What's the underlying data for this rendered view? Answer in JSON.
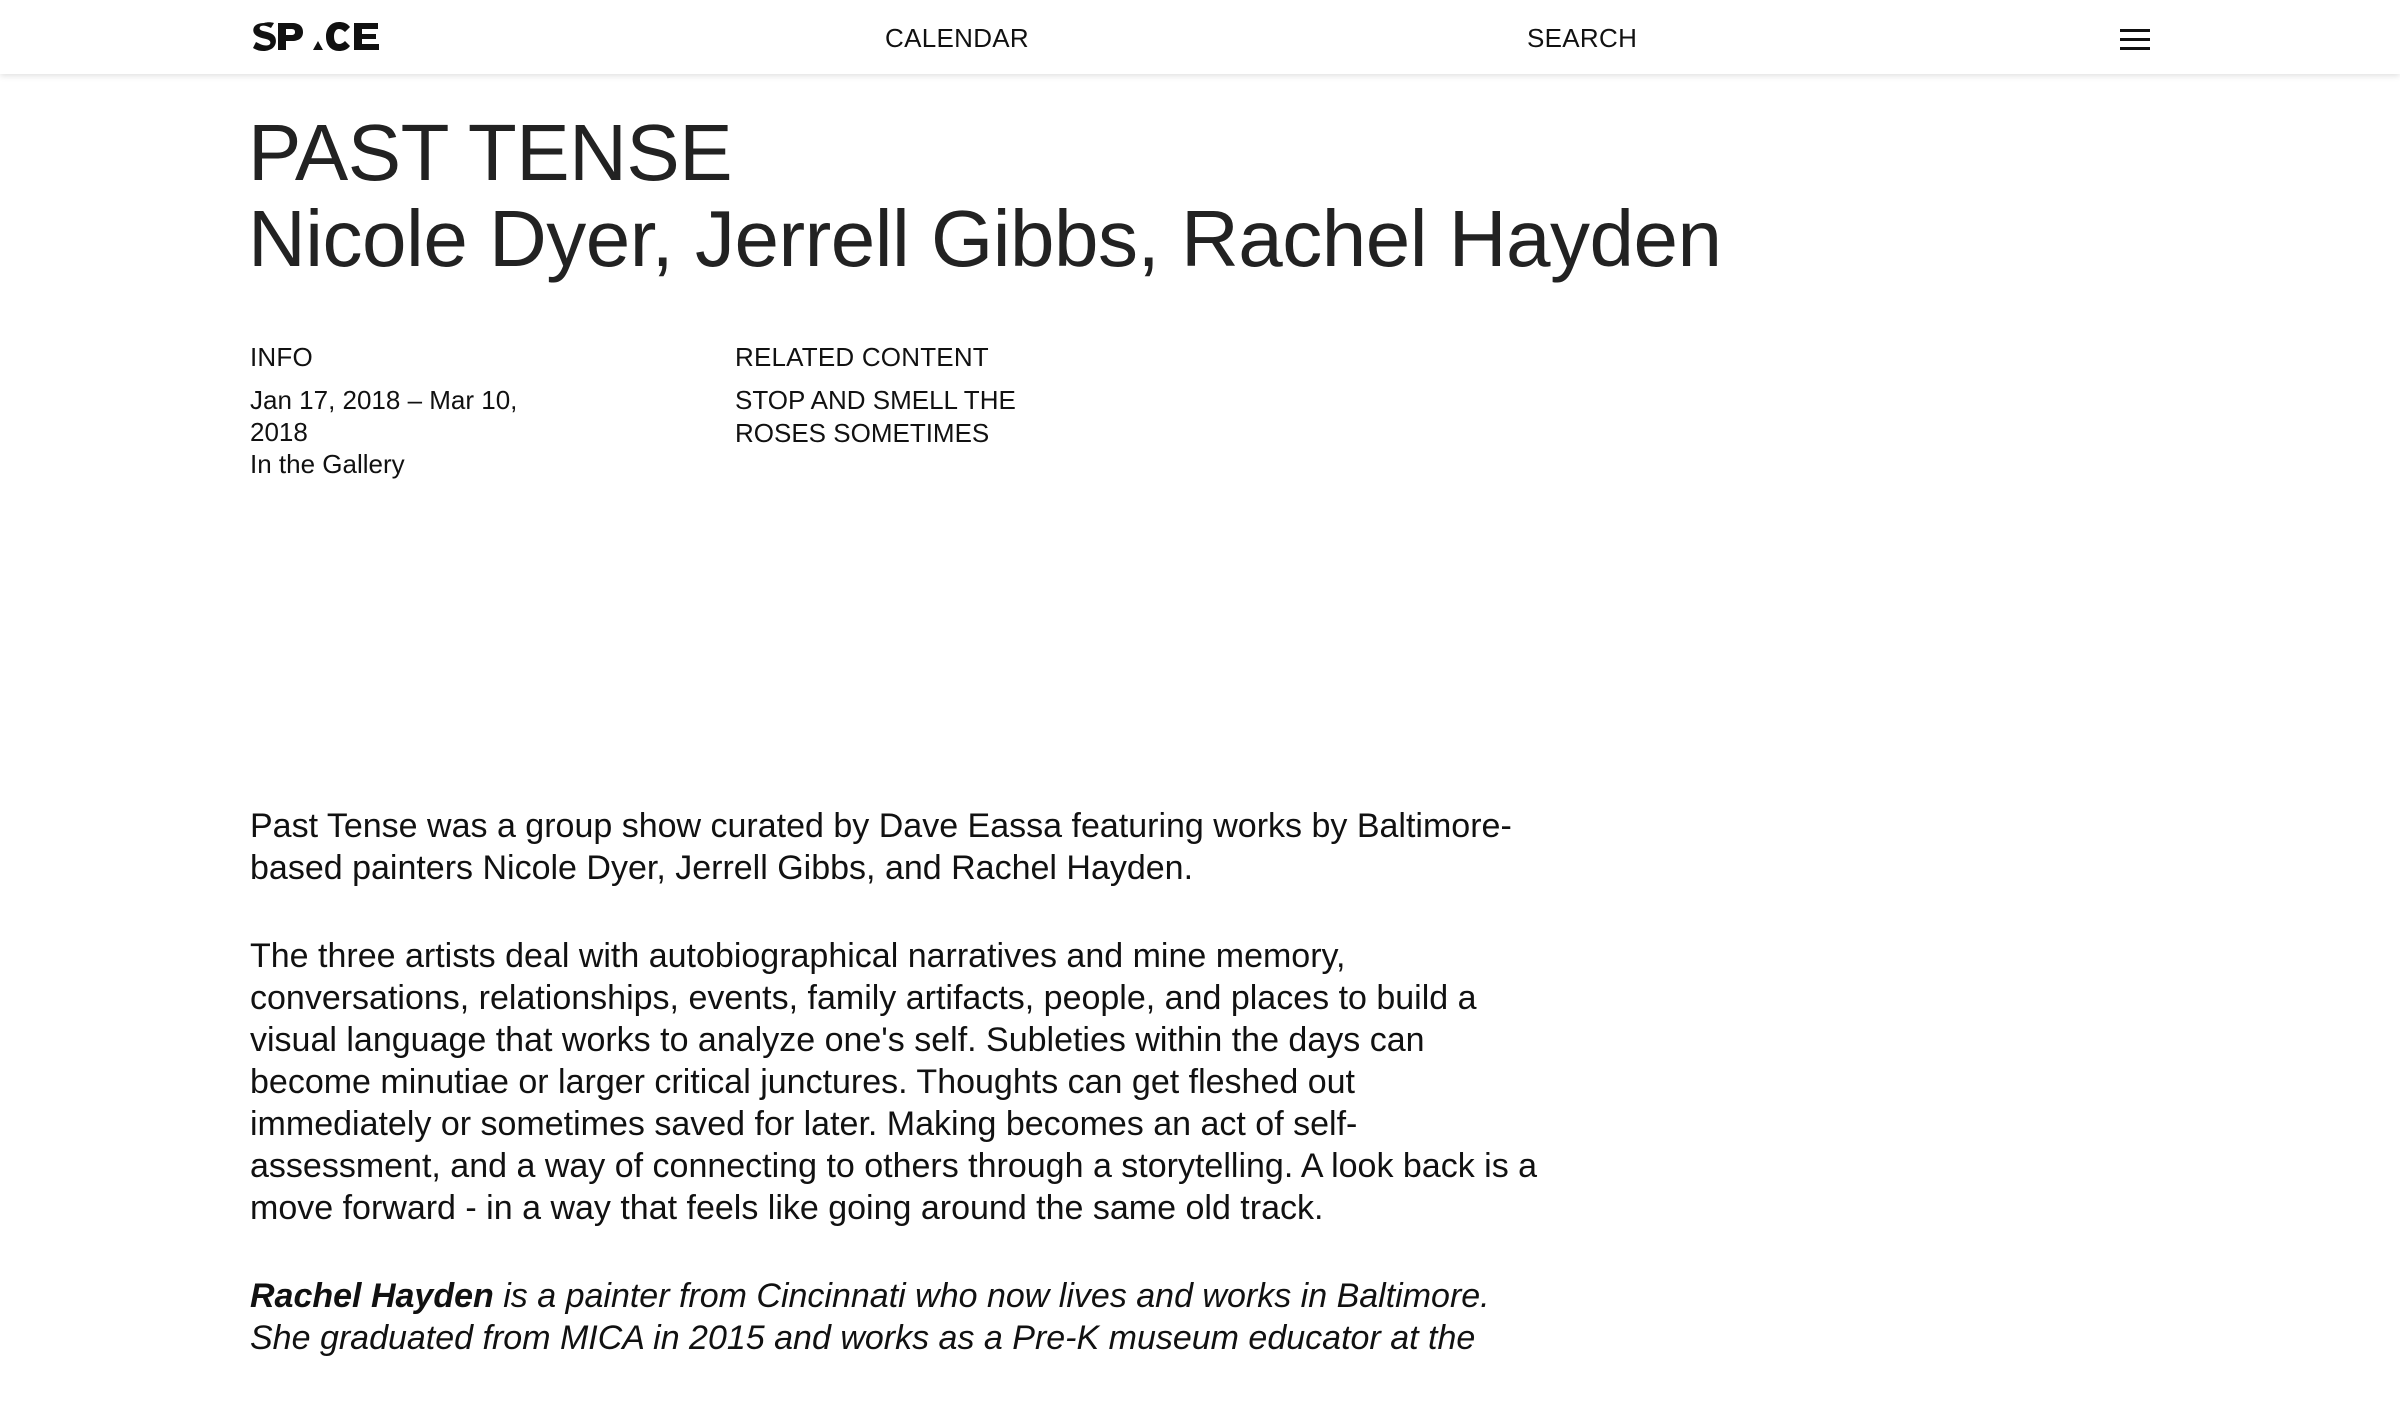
{
  "header": {
    "logo_text": "SPACE",
    "nav": {
      "calendar": "CALENDAR",
      "search": "SEARCH"
    },
    "menu_icon": "hamburger-menu-icon"
  },
  "exhibition": {
    "title": "PAST TENSE",
    "artists": "Nicole Dyer, Jerrell Gibbs, Rachel Hayden"
  },
  "info": {
    "heading": "INFO",
    "dates": "Jan 17, 2018 – Mar 10, 2018",
    "location": "In the Gallery"
  },
  "related": {
    "heading": "RELATED CONTENT",
    "items": [
      {
        "label": "STOP AND SMELL THE ROSES SOMETIMES"
      }
    ]
  },
  "article": {
    "paragraph_1": "Past Tense was a group show curated by Dave Eassa featuring works by Baltimore-based painters Nicole Dyer, Jerrell Gibbs, and Rachel Hayden.",
    "paragraph_2": "The three artists deal with autobiographical narratives and mine memory, conversations, relationships, events, family artifacts, people, and places to build a visual language that works to analyze one's self. Subleties within the days can become minutiae or larger critical junctures. Thoughts can get fleshed out immediately or sometimes saved for later. Making becomes an act of self-assessment, and a way of connecting to others through a storytelling. A look back is a move forward - in a way that feels like going around the same old track.",
    "bio_name": "Rachel Hayden",
    "bio_text": " is a painter from Cincinnati who now lives and works in Baltimore. She graduated from MICA in 2015 and works as a Pre-K museum educator at the"
  }
}
